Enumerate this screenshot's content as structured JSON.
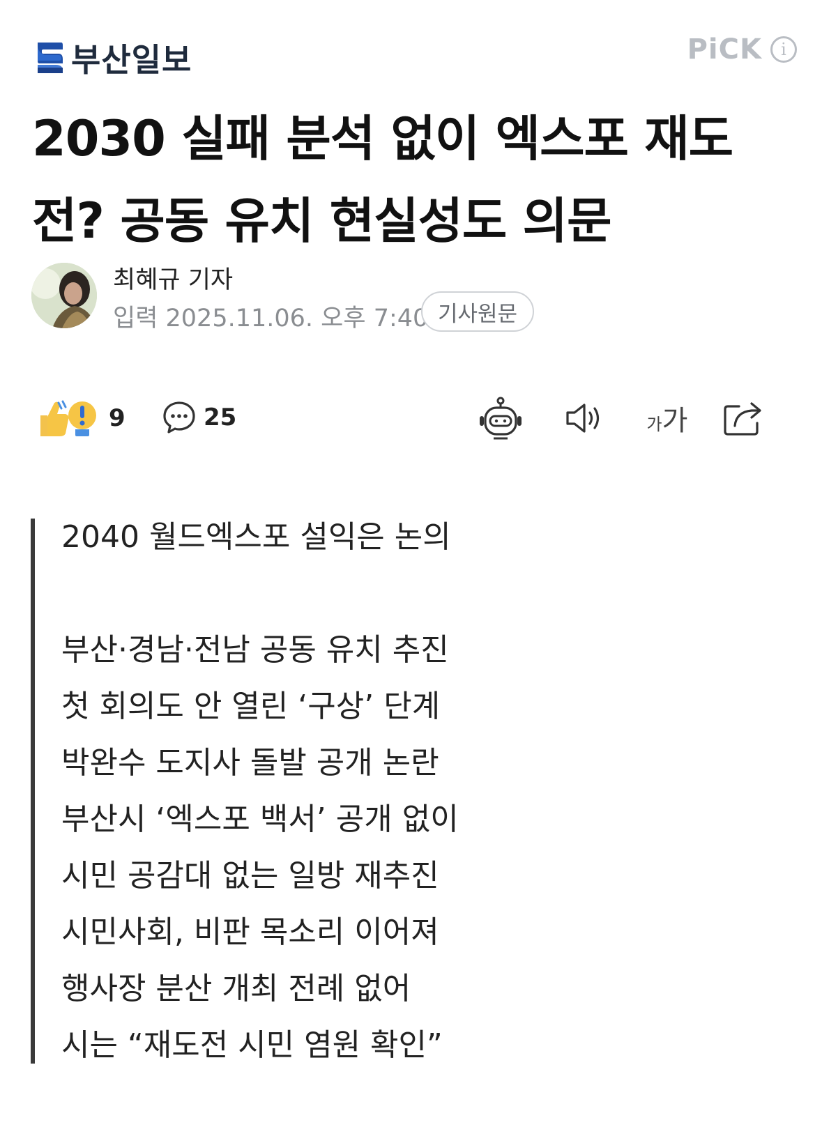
{
  "header": {
    "logo_text": "부산일보",
    "pick_label": "PiCK",
    "info_icon": "info-icon"
  },
  "article": {
    "title_line1": "2030 실패 분석 없이 엑스포 재도",
    "title_line2": "전? 공동 유치 현실성도 의문",
    "reporter": "최혜규 기자",
    "date": "입력 2025.11.06. 오후 7:40",
    "origin_button": "기사원문"
  },
  "toolbar": {
    "reaction_count": "9",
    "comment_count": "25",
    "icons": [
      "reaction-icon",
      "comment-icon",
      "ai-summary-robot-icon",
      "speaker-icon",
      "font-size-icon",
      "share-icon"
    ],
    "font_small": "가",
    "font_big": "가"
  },
  "summary": [
    "2040 월드엑스포 설익은 논의",
    "부산·경남·전남 공동 유치 추진",
    "첫 회의도 안 열린 ‘구상’ 단계",
    "박완수 도지사 돌발 공개 논란",
    "부산시 ‘엑스포 백서’ 공개 없이",
    "시민 공감대 없는 일방 재추진",
    "시민사회, 비판 목소리 이어져",
    "행사장 분산 개최 전례 없어",
    "시는 “재도전 시민 염원 확인”"
  ],
  "colors": {
    "logo_blue": "#1f4fa8",
    "pick_gray": "#b9bdc3",
    "quote_bar": "#3a3a3a"
  }
}
